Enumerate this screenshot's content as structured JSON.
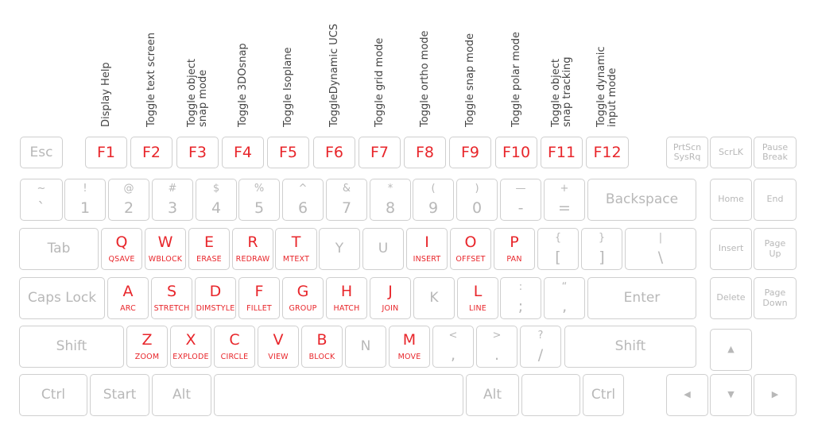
{
  "colors": {
    "accent": "#e8262b",
    "key_border": "#cfcfcf",
    "key_text": "#b8b8b8",
    "caption": "#444444"
  },
  "captions": [
    {
      "key": "F1",
      "text": "Display Help"
    },
    {
      "key": "F2",
      "text": "Toggle text screen"
    },
    {
      "key": "F3",
      "text": "Toggle object\nsnap mode"
    },
    {
      "key": "F4",
      "text": "Toggle 3DOsnap"
    },
    {
      "key": "F5",
      "text": "Toggle Isoplane"
    },
    {
      "key": "F6",
      "text": "ToggleDynamic UCS"
    },
    {
      "key": "F7",
      "text": "Toggle grid mode"
    },
    {
      "key": "F8",
      "text": "Toggle ortho mode"
    },
    {
      "key": "F9",
      "text": "Toggle snap mode"
    },
    {
      "key": "F10",
      "text": "Toggle polar mode"
    },
    {
      "key": "F11",
      "text": "Toggle object\nsnap tracking"
    },
    {
      "key": "F12",
      "text": "Toggle dynamic\ninput mode"
    }
  ],
  "keys": [
    {
      "main": "Esc",
      "type": "esc"
    },
    {
      "main": "F1",
      "type": "fkey"
    },
    {
      "main": "F2",
      "type": "fkey"
    },
    {
      "main": "F3",
      "type": "fkey"
    },
    {
      "main": "F4",
      "type": "fkey"
    },
    {
      "main": "F5",
      "type": "fkey"
    },
    {
      "main": "F6",
      "type": "fkey"
    },
    {
      "main": "F7",
      "type": "fkey"
    },
    {
      "main": "F8",
      "type": "fkey"
    },
    {
      "main": "F9",
      "type": "fkey"
    },
    {
      "main": "F10",
      "type": "fkey"
    },
    {
      "main": "F11",
      "type": "fkey"
    },
    {
      "main": "F12",
      "type": "fkey"
    },
    {
      "main": "PrtScn\nSysRq",
      "type": "small"
    },
    {
      "main": "ScrLK",
      "type": "small"
    },
    {
      "main": "Pause\nBreak",
      "type": "small"
    },
    {
      "shift": "~",
      "main": "`",
      "type": "dual"
    },
    {
      "shift": "!",
      "main": "1",
      "type": "dual"
    },
    {
      "shift": "@",
      "main": "2",
      "type": "dual"
    },
    {
      "shift": "#",
      "main": "3",
      "type": "dual"
    },
    {
      "shift": "$",
      "main": "4",
      "type": "dual"
    },
    {
      "shift": "%",
      "main": "5",
      "type": "dual"
    },
    {
      "shift": "^",
      "main": "6",
      "type": "dual"
    },
    {
      "shift": "&",
      "main": "7",
      "type": "dual"
    },
    {
      "shift": "*",
      "main": "8",
      "type": "dual"
    },
    {
      "shift": "(",
      "main": "9",
      "type": "dual"
    },
    {
      "shift": ")",
      "main": "0",
      "type": "dual"
    },
    {
      "shift": "—",
      "main": "-",
      "type": "dual"
    },
    {
      "shift": "+",
      "main": "=",
      "type": "dual"
    },
    {
      "main": "Backspace",
      "type": "plain"
    },
    {
      "main": "Home",
      "type": "small"
    },
    {
      "main": "End",
      "type": "small"
    },
    {
      "main": "Tab",
      "type": "plain"
    },
    {
      "main": "Q",
      "cmd": "QSAVE",
      "type": "active"
    },
    {
      "main": "W",
      "cmd": "WBLOCK",
      "type": "active"
    },
    {
      "main": "E",
      "cmd": "ERASE",
      "type": "active"
    },
    {
      "main": "R",
      "cmd": "REDRAW",
      "type": "active"
    },
    {
      "main": "T",
      "cmd": "MTEXT",
      "type": "active"
    },
    {
      "main": "Y",
      "type": "plain"
    },
    {
      "main": "U",
      "type": "plain"
    },
    {
      "main": "I",
      "cmd": "INSERT",
      "type": "active"
    },
    {
      "main": "O",
      "cmd": "OFFSET",
      "type": "active"
    },
    {
      "main": "P",
      "cmd": "PAN",
      "type": "active"
    },
    {
      "shift": "{",
      "main": "[",
      "type": "dual"
    },
    {
      "shift": "}",
      "main": "]",
      "type": "dual"
    },
    {
      "shift": "|",
      "main": "\\",
      "type": "dual"
    },
    {
      "main": "Insert",
      "type": "small"
    },
    {
      "main": "Page\nUp",
      "type": "small"
    },
    {
      "main": "Caps Lock",
      "type": "plain"
    },
    {
      "main": "A",
      "cmd": "ARC",
      "type": "active"
    },
    {
      "main": "S",
      "cmd": "STRETCH",
      "type": "active"
    },
    {
      "main": "D",
      "cmd": "DIMSTYLE",
      "type": "active"
    },
    {
      "main": "F",
      "cmd": "FILLET",
      "type": "active"
    },
    {
      "main": "G",
      "cmd": "GROUP",
      "type": "active"
    },
    {
      "main": "H",
      "cmd": "HATCH",
      "type": "active"
    },
    {
      "main": "J",
      "cmd": "JOIN",
      "type": "active"
    },
    {
      "main": "K",
      "type": "plain"
    },
    {
      "main": "L",
      "cmd": "LINE",
      "type": "active"
    },
    {
      "shift": ":",
      "main": ";",
      "type": "dual"
    },
    {
      "shift": "“",
      "main": "‚",
      "type": "dual"
    },
    {
      "main": "Enter",
      "type": "plain"
    },
    {
      "main": "Delete",
      "type": "small"
    },
    {
      "main": "Page\nDown",
      "type": "small"
    },
    {
      "main": "Shift",
      "type": "plain"
    },
    {
      "main": "Z",
      "cmd": "ZOOM",
      "type": "active"
    },
    {
      "main": "X",
      "cmd": "EXPLODE",
      "type": "active"
    },
    {
      "main": "C",
      "cmd": "CIRCLE",
      "type": "active"
    },
    {
      "main": "V",
      "cmd": "VIEW",
      "type": "active"
    },
    {
      "main": "B",
      "cmd": "BLOCK",
      "type": "active"
    },
    {
      "main": "N",
      "type": "plain"
    },
    {
      "main": "M",
      "cmd": "MOVE",
      "type": "active"
    },
    {
      "shift": "<",
      "main": ",",
      "type": "dual"
    },
    {
      "shift": ">",
      "main": ".",
      "type": "dual"
    },
    {
      "shift": "?",
      "main": "/",
      "type": "dual"
    },
    {
      "main": "Shift",
      "type": "plain"
    },
    {
      "main": "▲",
      "type": "small",
      "icon": "arrow-up-icon"
    },
    {
      "main": "Ctrl",
      "type": "plain"
    },
    {
      "main": "Start",
      "type": "plain"
    },
    {
      "main": "Alt",
      "type": "plain"
    },
    {
      "main": "",
      "type": "plain"
    },
    {
      "main": "Alt",
      "type": "plain"
    },
    {
      "main": "",
      "type": "plain"
    },
    {
      "main": "Ctrl",
      "type": "plain"
    },
    {
      "main": "◀",
      "type": "small",
      "icon": "arrow-left-icon"
    },
    {
      "main": "▼",
      "type": "small",
      "icon": "arrow-down-icon"
    },
    {
      "main": "▶",
      "type": "small",
      "icon": "arrow-right-icon"
    }
  ]
}
